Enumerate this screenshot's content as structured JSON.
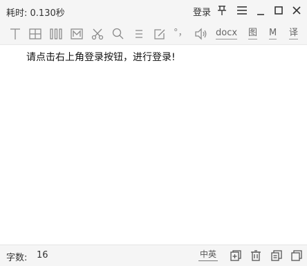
{
  "titlebar": {
    "elapsed_label": "耗时:",
    "elapsed_value": "0.130秒",
    "login_label": "登录",
    "icons": [
      "pin-icon",
      "menu-icon",
      "minimize-icon",
      "maximize-icon",
      "close-icon"
    ]
  },
  "toolbar": {
    "docx_label": "docx",
    "image_label": "图",
    "m_label": "M",
    "translate_label": "译",
    "punct_label": "°，",
    "icons": [
      "text-cursor-icon",
      "table-grid-icon",
      "columns-icon",
      "markdown-m-icon",
      "scissors-icon",
      "search-icon",
      "align-lines-icon",
      "edit-box-icon",
      "punctuation-icon",
      "speaker-icon"
    ]
  },
  "content": {
    "message": "请点击右上角登录按钮，进行登录!"
  },
  "statusbar": {
    "count_label": "字数:",
    "count_value": "16",
    "lang_label": "中英",
    "icons": [
      "add-page-icon",
      "trash-icon",
      "copy-icon",
      "copy-window-icon"
    ]
  }
}
